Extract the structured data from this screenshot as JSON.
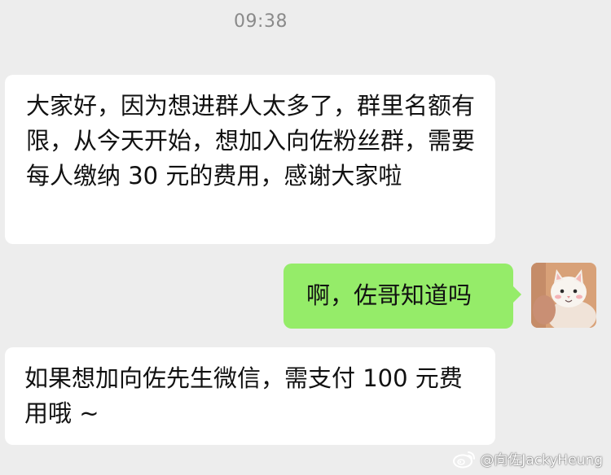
{
  "status": {
    "time": "09:38"
  },
  "messages": [
    {
      "side": "left",
      "text": "大家好，因为想进群人太多了，群里名额有限，从今天开始，想加入向佐粉丝群，需要每人缴纳 30 元的费用，感谢大家啦"
    },
    {
      "side": "right",
      "text": "啊，佐哥知道吗"
    },
    {
      "side": "left",
      "text": "如果想加向佐先生微信，需支付 100 元费用哦 ~"
    }
  ],
  "avatar": {
    "icon": "cat-avatar-icon"
  },
  "watermark": {
    "text": "@向佐JackyHeung",
    "icon": "weibo-logo-icon"
  },
  "colors": {
    "background": "#ededed",
    "incoming_bubble": "#ffffff",
    "outgoing_bubble": "#95ec69",
    "timestamp": "#8a8a8a"
  }
}
